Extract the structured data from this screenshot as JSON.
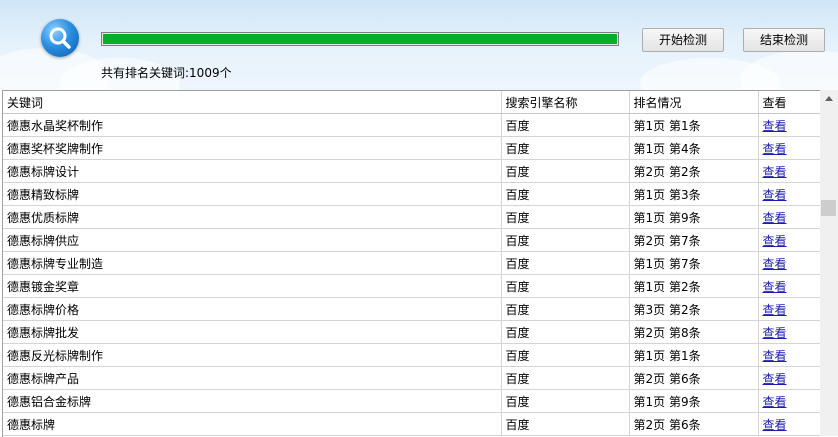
{
  "header": {
    "start_button": "开始检测",
    "stop_button": "结束检测",
    "progress": 1.0,
    "summary": "共有排名关键词:1009个",
    "progress_color": "#06b025"
  },
  "table": {
    "columns": [
      "关键词",
      "搜索引擎名称",
      "排名情况",
      "查看"
    ],
    "rows": [
      {
        "keyword": "德惠水晶奖杯制作",
        "engine": "百度",
        "rank": "第1页 第1条",
        "view": "查看"
      },
      {
        "keyword": "德惠奖杯奖牌制作",
        "engine": "百度",
        "rank": "第1页 第4条",
        "view": "查看"
      },
      {
        "keyword": "德惠标牌设计",
        "engine": "百度",
        "rank": "第2页 第2条",
        "view": "查看"
      },
      {
        "keyword": "德惠精致标牌",
        "engine": "百度",
        "rank": "第1页 第3条",
        "view": "查看"
      },
      {
        "keyword": "德惠优质标牌",
        "engine": "百度",
        "rank": "第1页 第9条",
        "view": "查看"
      },
      {
        "keyword": "德惠标牌供应",
        "engine": "百度",
        "rank": "第2页 第7条",
        "view": "查看"
      },
      {
        "keyword": "德惠标牌专业制造",
        "engine": "百度",
        "rank": "第1页 第7条",
        "view": "查看"
      },
      {
        "keyword": "德惠镀金奖章",
        "engine": "百度",
        "rank": "第1页 第2条",
        "view": "查看"
      },
      {
        "keyword": "德惠标牌价格",
        "engine": "百度",
        "rank": "第3页 第2条",
        "view": "查看"
      },
      {
        "keyword": "德惠标牌批发",
        "engine": "百度",
        "rank": "第2页 第8条",
        "view": "查看"
      },
      {
        "keyword": "德惠反光标牌制作",
        "engine": "百度",
        "rank": "第1页 第1条",
        "view": "查看"
      },
      {
        "keyword": "德惠标牌产品",
        "engine": "百度",
        "rank": "第2页 第6条",
        "view": "查看"
      },
      {
        "keyword": "德惠铝合金标牌",
        "engine": "百度",
        "rank": "第1页 第9条",
        "view": "查看"
      },
      {
        "keyword": "德惠标牌",
        "engine": "百度",
        "rank": "第2页 第6条",
        "view": "查看"
      }
    ]
  },
  "icons": {
    "logo": "search-magnifier-icon",
    "scroll_up": "scroll-up-arrow-icon"
  },
  "colors": {
    "link": "#1c1cb2",
    "header_bg": "#cfe6f7"
  }
}
